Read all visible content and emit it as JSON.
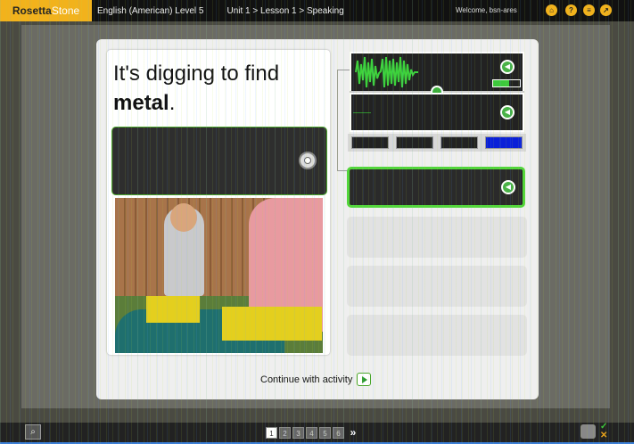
{
  "header": {
    "logo_rosetta": "Rosetta",
    "logo_stone": "Stone",
    "course": "English (American) Level 5",
    "breadcrumb": "Unit 1 > Lesson 1 > Speaking",
    "welcome": "Welcome, bsn-ares",
    "icons": [
      "home-icon",
      "help-icon",
      "menu-icon",
      "exit-icon"
    ]
  },
  "prompt": {
    "line1": "It's digging to find",
    "line2_bold": "metal",
    "line2_end": "."
  },
  "speech": {
    "level_fraction": 0.6,
    "modes": [
      "waveform-mode",
      "pitch-mode",
      "contour-mode",
      "spectrogram-mode"
    ],
    "active_mode": "spectrogram-mode"
  },
  "activity": {
    "continue_label": "Continue with activity"
  },
  "pager": {
    "pages": [
      "1",
      "2",
      "3",
      "4",
      "5",
      "6"
    ],
    "current": "1",
    "next_label": "»"
  },
  "colors": {
    "accent_green": "#52d63a",
    "brand_gold": "#f2b21c"
  }
}
